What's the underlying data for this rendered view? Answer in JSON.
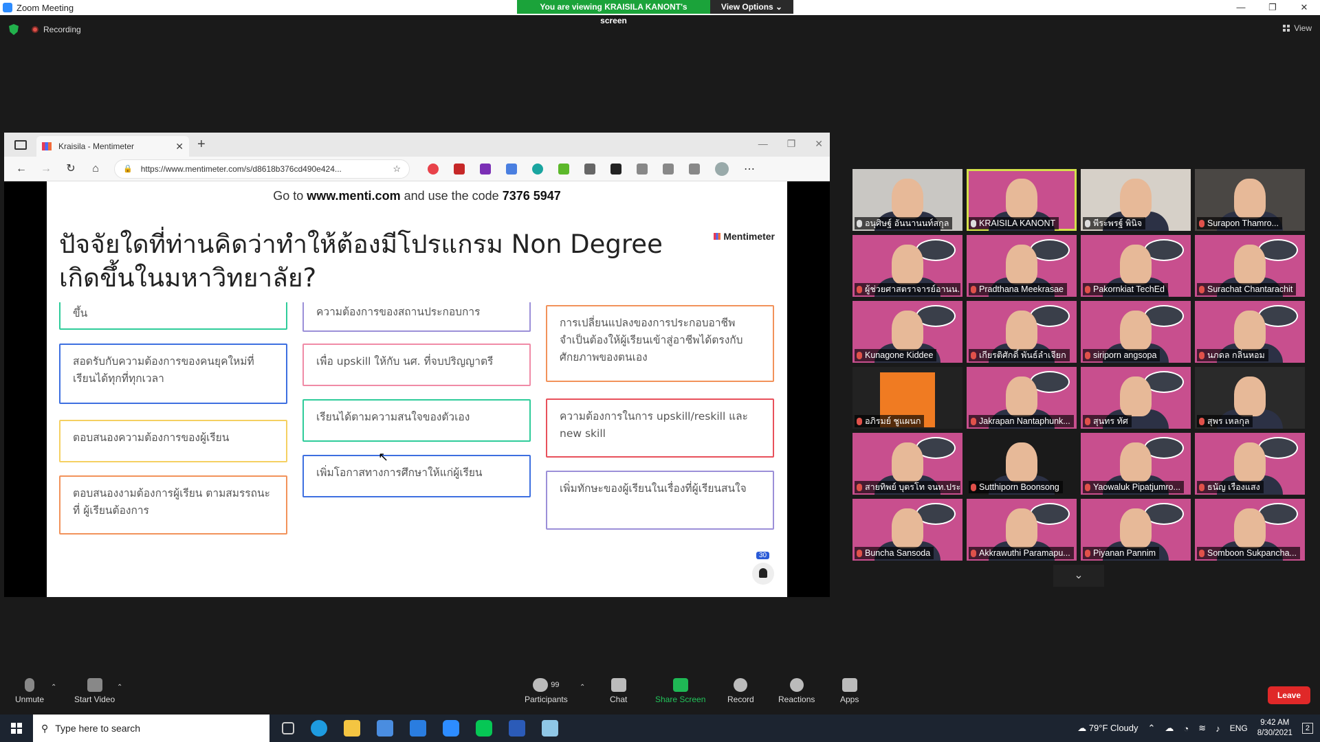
{
  "window": {
    "title": "Zoom Meeting",
    "share_banner": "You are viewing KRAISILA KANONT's screen",
    "view_options": "View Options ⌄",
    "recording": "Recording",
    "view_label": "View"
  },
  "browser": {
    "tab_title": "Kraisila - Mentimeter",
    "url": "https://www.mentimeter.com/s/d8618b376cd490e424..."
  },
  "slide": {
    "instructions_pre": "Go to ",
    "site": "www.menti.com",
    "instructions_mid": " and use the code ",
    "code": "7376 5947",
    "logo": "Mentimeter",
    "question": "ปัจจัยใดที่ท่านคิดว่าทำให้ต้องมีโปรแกรม Non Degree เกิดขึ้นในมหาวิทยาลัย?",
    "response_count": "30",
    "cards": [
      {
        "text": "ขึ้น",
        "color": "#2ecc9a"
      },
      {
        "text": "ความต้องการของสถานประกอบการ",
        "color": "#9b8fd8"
      },
      {
        "text": "การเปลี่ยนแปลงของการประกอบอาชีพ จำเป็นต้องให้ผู้เรียนเข้าสู่อาชีพได้ตรงกับศักยภาพของตนเอง",
        "color": "#f2925a"
      },
      {
        "text": "สอดรับกับความต้องการของคนยุคใหม่ที่เรียนได้ทุกที่ทุกเวลา",
        "color": "#3d6fe0"
      },
      {
        "text": "เพื่อ upskill ให้กับ นศ. ที่จบปริญญาตรี",
        "color": "#f08aa6"
      },
      {
        "text": "เรียนได้ตามความสนใจของตัวเอง",
        "color": "#2ecc9a"
      },
      {
        "text": "ความต้องการในการ upskill/reskill และ new skill",
        "color": "#e8505b"
      },
      {
        "text": "ตอบสนองความต้องการของผู้เรียน",
        "color": "#f5d061"
      },
      {
        "text": "เพิ่มโอกาสทางการศึกษาให้แก่ผู้เรียน",
        "color": "#3d6fe0"
      },
      {
        "text": "เพิ่มทักษะของผู้เรียนในเรื่องที่ผู้เรียนสนใจ",
        "color": "#9b8fd8"
      },
      {
        "text": "ตอบสนองงามต้องการผู้เรียน ตามสมรรถนะที่ ผู้เรียนต้องการ",
        "color": "#f2925a"
      }
    ]
  },
  "participants": [
    {
      "name": "อนุศิษฐ์ อันนานนท์สกุล",
      "muted": false
    },
    {
      "name": "KRAISILA KANONT",
      "muted": false
    },
    {
      "name": "พีระพรฐ์ พินิจ",
      "muted": false
    },
    {
      "name": "Surapon Thamro...",
      "muted": true
    },
    {
      "name": "ผู้ช่วยศาสตราจารย์อานน...",
      "muted": true
    },
    {
      "name": "Pradthana Meekrasae",
      "muted": true
    },
    {
      "name": "Pakornkiat TechEd",
      "muted": true
    },
    {
      "name": "Surachat Chantarachit",
      "muted": true
    },
    {
      "name": "Kunagone Kiddee",
      "muted": true
    },
    {
      "name": "เกียรติศักดิ์ พันธ์ลำเจียก",
      "muted": true
    },
    {
      "name": "siriporn angsopa",
      "muted": true
    },
    {
      "name": "นภดล กลิ่นหอม",
      "muted": true
    },
    {
      "name": "อภิรมย์ ชูแผนก",
      "muted": true
    },
    {
      "name": "Jakrapan Nantaphunk...",
      "muted": true
    },
    {
      "name": "สุนทร ทัศ",
      "muted": true
    },
    {
      "name": "สุพร เหลกุล",
      "muted": true
    },
    {
      "name": "สายทิพย์ บุตรโท จนท.ประ...",
      "muted": true
    },
    {
      "name": "Sutthiporn Boonsong",
      "muted": true
    },
    {
      "name": "Yaowaluk Pipatjumro...",
      "muted": true
    },
    {
      "name": "ธนัญ เรืองแสง",
      "muted": true
    },
    {
      "name": "Buncha Sansoda",
      "muted": true
    },
    {
      "name": "Akkrawuthi Paramapu...",
      "muted": true
    },
    {
      "name": "Piyanan Pannim",
      "muted": true
    },
    {
      "name": "Somboon Sukpancha...",
      "muted": true
    }
  ],
  "toolbar": {
    "unmute": "Unmute",
    "start_video": "Start Video",
    "participants": "Participants",
    "participant_count": "99",
    "chat": "Chat",
    "share_screen": "Share Screen",
    "record": "Record",
    "reactions": "Reactions",
    "apps": "Apps",
    "leave": "Leave"
  },
  "taskbar": {
    "search_placeholder": "Type here to search",
    "weather": "79°F  Cloudy",
    "lang": "ENG",
    "time": "9:42 AM",
    "date": "8/30/2021",
    "notifications": "2"
  }
}
